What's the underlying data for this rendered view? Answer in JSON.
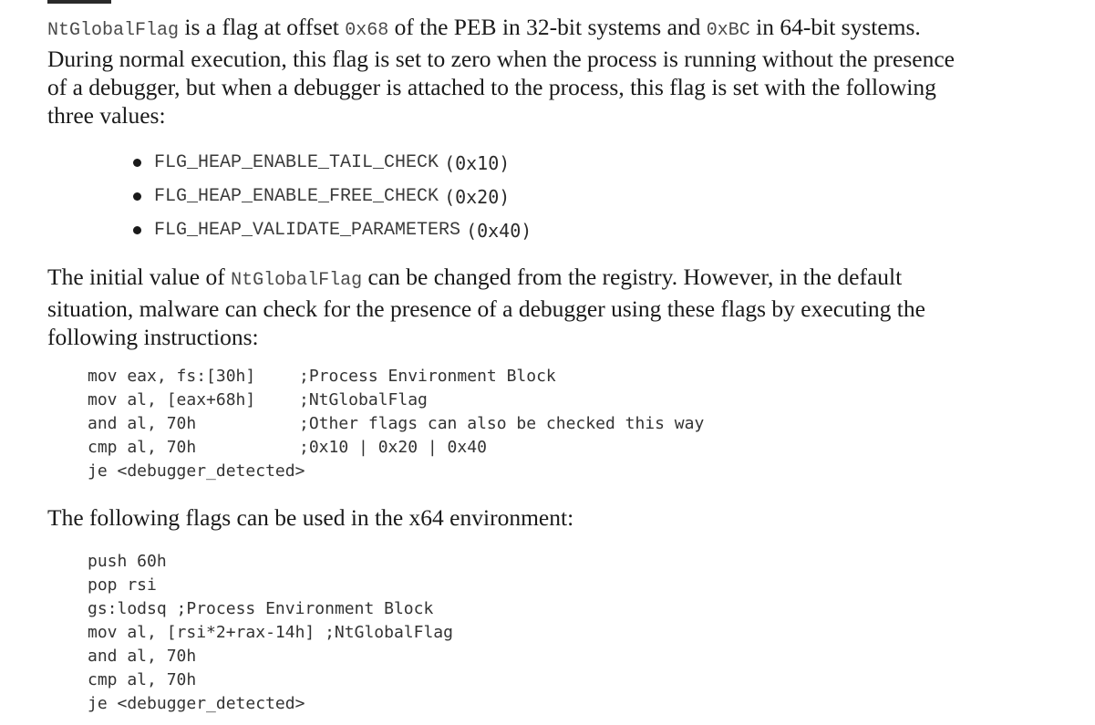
{
  "intro": {
    "flag_name": "NtGlobalFlag",
    "text_1": " is a flag at offset ",
    "offset_32": "0x68",
    "text_2": " of the PEB in 32-bit systems and ",
    "offset_64": "0xBC",
    "text_3": " in 64-bit systems. During normal execution, this flag is set to zero when the process is running without the presence of a debugger, but when a debugger is attached to the process, this flag is set with the following three values:"
  },
  "flags": [
    {
      "name": "FLG_HEAP_ENABLE_TAIL_CHECK",
      "value": "(0x10)"
    },
    {
      "name": "FLG_HEAP_ENABLE_FREE_CHECK",
      "value": "(0x20)"
    },
    {
      "name": "FLG_HEAP_VALIDATE_PARAMETERS",
      "value": "(0x40)"
    }
  ],
  "registry_para": {
    "text_1": "The initial value of ",
    "flag_name": "NtGlobalFlag",
    "text_2": " can be changed from the registry. However, in the default situation, malware can check for the presence of a debugger using these flags by executing the following instructions:"
  },
  "code_x86": [
    {
      "instr": "mov eax, fs:[30h]",
      "comment": ";Process Environment Block"
    },
    {
      "instr": "mov al, [eax+68h]",
      "comment": ";NtGlobalFlag"
    },
    {
      "instr": "and al, 70h",
      "comment": ";Other flags can also be checked this way"
    },
    {
      "instr": "cmp al, 70h",
      "comment": ";0x10 | 0x20 | 0x40"
    },
    {
      "instr": "je <debugger_detected>",
      "comment": ""
    }
  ],
  "x64_intro": "The following flags can be used in the x64 environment:",
  "code_x64": [
    {
      "instr": "push 60h",
      "comment": ""
    },
    {
      "instr": "pop rsi",
      "comment": ""
    },
    {
      "instr": "gs:lodsq ",
      "comment": ";Process Environment Block"
    },
    {
      "instr": "mov al, [rsi*2+rax-14h] ",
      "comment": ";NtGlobalFlag"
    },
    {
      "instr": "and al, 70h",
      "comment": ""
    },
    {
      "instr": "cmp al, 70h",
      "comment": ""
    },
    {
      "instr": "je <debugger_detected>",
      "comment": ""
    }
  ]
}
